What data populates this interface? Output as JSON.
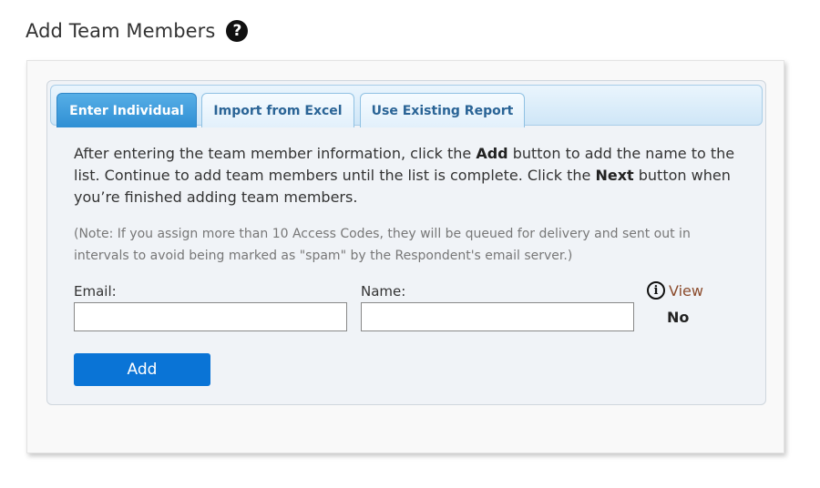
{
  "header": {
    "title": "Add Team Members",
    "help_symbol": "?"
  },
  "tabs": [
    {
      "label": "Enter Individual",
      "active": true
    },
    {
      "label": "Import from Excel",
      "active": false
    },
    {
      "label": "Use Existing Report",
      "active": false
    }
  ],
  "instructions": {
    "part1": "After entering the team member information, click the ",
    "add_word": "Add",
    "part2": " button to add the name to the list. Continue to add team members until the list is complete. Click the ",
    "next_word": "Next",
    "part3": " button when you’re finished adding team members."
  },
  "note": "(Note: If you assign more than 10 Access Codes, they will be queued for delivery and sent out in intervals to avoid being marked as \"spam\" by the Respondent's email server.)",
  "form": {
    "email_label": "Email:",
    "email_value": "",
    "name_label": "Name:",
    "name_value": "",
    "view_label": "View",
    "view_value": "No",
    "info_symbol": "i",
    "add_label": "Add"
  },
  "colors": {
    "active_tab": "#2f8fd4",
    "tab_text": "#2a6496",
    "add_button": "#0a74d6",
    "view_link": "#8b4b2c"
  }
}
